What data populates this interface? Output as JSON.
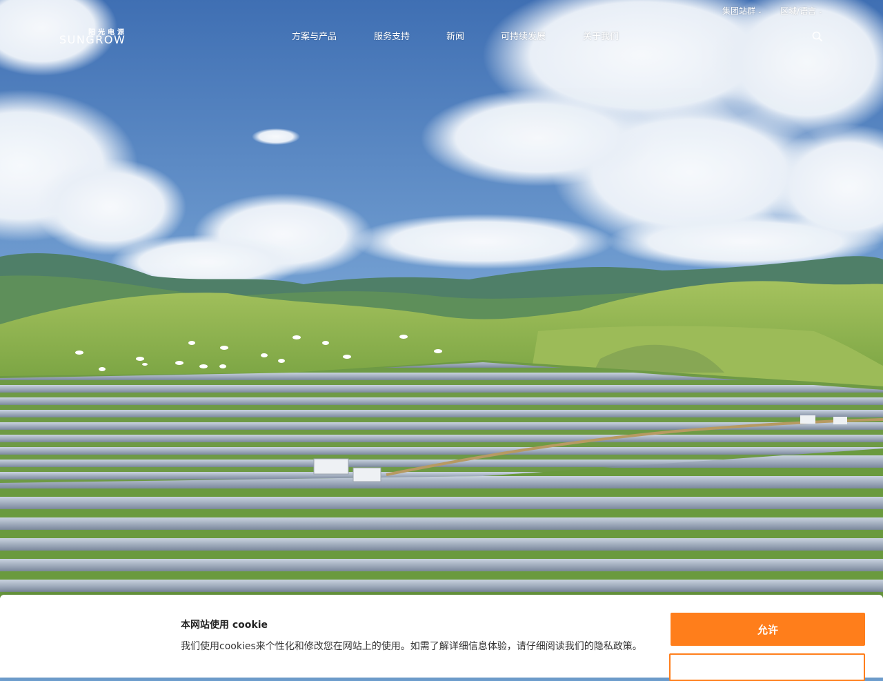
{
  "brand": {
    "logo_cn": "阳光电源",
    "logo_en": "SUNGROW",
    "accent_color": "#ff7e1b"
  },
  "header": {
    "nav": [
      {
        "label": "方案与产品"
      },
      {
        "label": "服务支持"
      },
      {
        "label": "新闻"
      },
      {
        "label": "可持续发展"
      },
      {
        "label": "关于我们"
      }
    ],
    "utility": [
      {
        "label": "集团站群",
        "icon": "chevron-down-icon"
      },
      {
        "label": "区域/语言",
        "icon": "chevron-down-icon"
      }
    ],
    "search_icon": "search-icon"
  },
  "hero": {
    "scene": "solar farm on green grassland under blue sky with clouds"
  },
  "cookie_banner": {
    "title": "本网站使用 cookie",
    "body": "我们使用cookies来个性化和修改您在网站上的使用。如需了解详细信息体验，请仔细阅读我们的隐私政策。",
    "allow_label": "允许",
    "second_label": ""
  }
}
